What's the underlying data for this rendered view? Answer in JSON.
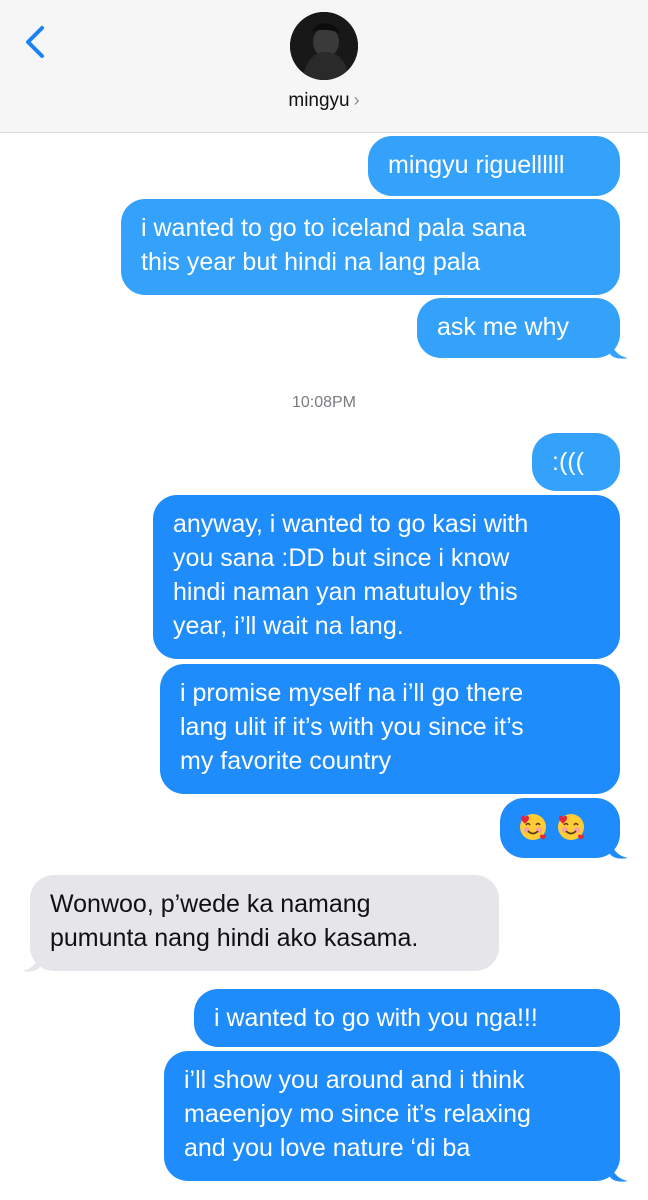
{
  "header": {
    "contact_name": "mingyu",
    "chevron": "›",
    "back_icon": "chevron-left-icon",
    "accent": "#1a82f7"
  },
  "colors": {
    "sent_bubble": "#1e8cfb",
    "sent_bubble_light": "#34a1fb",
    "received_bubble": "#e5e5ea"
  },
  "timestamp": "10:08PM",
  "messages": [
    {
      "from": "me",
      "text": "mingyu riguellllll"
    },
    {
      "from": "me",
      "lines": [
        "i wanted to go to iceland pala sana",
        "this year but hindi na lang pala"
      ]
    },
    {
      "from": "me",
      "text": "ask me why"
    },
    {
      "from": "me",
      "text": ":((("
    },
    {
      "from": "me",
      "lines": [
        "anyway, i wanted to go kasi with",
        "you sana :DD but since i know",
        "hindi naman yan matutuloy this",
        "year, i’ll wait na lang."
      ]
    },
    {
      "from": "me",
      "lines": [
        "i promise myself na i’ll go there",
        "lang ulit if it’s with you since it’s",
        "my favorite country"
      ]
    },
    {
      "from": "me",
      "emoji": [
        "smiling-face-with-hearts",
        "smiling-face-with-hearts"
      ]
    },
    {
      "from": "them",
      "lines": [
        "Wonwoo, p’wede ka namang",
        "pumunta nang hindi ako kasama."
      ]
    },
    {
      "from": "me",
      "text": "i wanted to go with you nga!!!"
    },
    {
      "from": "me",
      "lines": [
        "i’ll show you around and i think",
        "maeenjoy mo since it’s relaxing",
        "and you love nature ‘di ba"
      ]
    }
  ]
}
